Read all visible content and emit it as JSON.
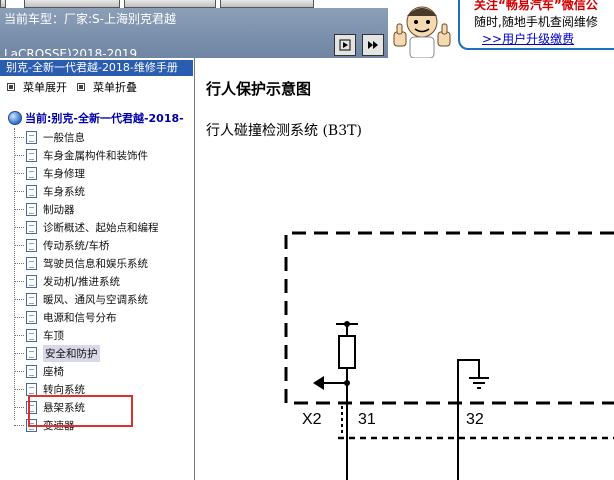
{
  "header": {
    "car_label": "当前车型：",
    "car_value": "厂家:S-上海别克君越",
    "car_model": "LaCROSSE)2018-2019",
    "nav_prev_icon": "step-right-icon",
    "nav_next_icon": "skip-end-icon",
    "mascot_icon": "mascot-thumbs-up-icon"
  },
  "promo": {
    "line1": "关注“畅易汽车”微信公",
    "line2": "随时,随地手机查阅维修",
    "link": ">>用户升级缴费"
  },
  "sidebar": {
    "manual_title": "别克-全新一代君越-2018-维修手册",
    "expand_label": "菜单展开",
    "collapse_label": "菜单折叠",
    "current_label": "当前:别克-全新一代君越-2018-",
    "items": [
      {
        "label": "一般信息"
      },
      {
        "label": "车身金属构件和装饰件"
      },
      {
        "label": "车身修理"
      },
      {
        "label": "车身系统"
      },
      {
        "label": "制动器"
      },
      {
        "label": "诊断概述、起始点和编程"
      },
      {
        "label": "传动系统/车桥"
      },
      {
        "label": "驾驶员信息和娱乐系统"
      },
      {
        "label": "发动机/推进系统"
      },
      {
        "label": "暖风、通风与空调系统"
      },
      {
        "label": "电源和信号分布"
      },
      {
        "label": "车顶"
      },
      {
        "label": "安全和防护"
      },
      {
        "label": "座椅"
      },
      {
        "label": "转向系统"
      },
      {
        "label": "悬架系统"
      },
      {
        "label": "变速器"
      }
    ],
    "selected_index": 12
  },
  "content": {
    "title": "行人保护示意图",
    "subtitle": "行人碰撞检测系统 (B3T)",
    "diagram": {
      "connector": "X2",
      "pin_a": "31",
      "pin_b": "32"
    }
  },
  "colors": {
    "header_bar": "#7b8fac",
    "title_bar": "#2a5db0",
    "current_text": "#0000a8",
    "highlight": "#e0302e",
    "promo_border": "#1a6fc0",
    "promo_red": "#d40000"
  }
}
